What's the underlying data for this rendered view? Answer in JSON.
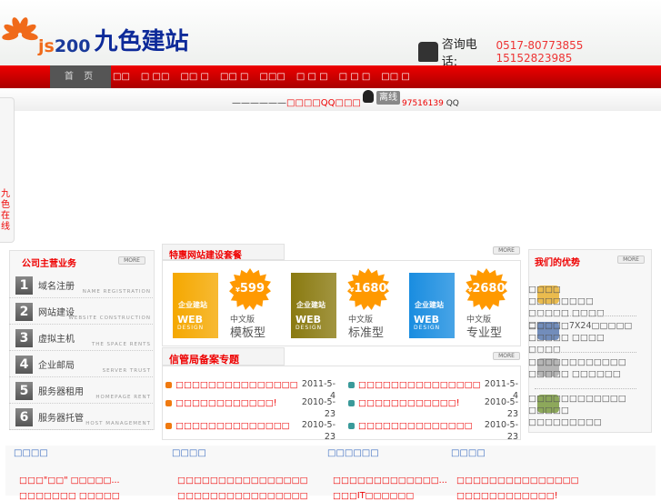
{
  "header": {
    "logo_js": "js",
    "logo_num": "200",
    "logo_cn": "九色建站",
    "phone_label": "咨询电话:",
    "phones": "0517-80773855  15152823985"
  },
  "nav": {
    "home": "首 页",
    "items": [
      "□□",
      "□ □□",
      "□□ □",
      "□□ □",
      "□□□",
      "□ □ □",
      "□ □ □",
      "□□ □"
    ]
  },
  "qq": {
    "dashes": "——————",
    "text": "□□□□QQ□□□",
    "status": "离线",
    "number": "97516139",
    "suffix": "QQ"
  },
  "side_tab": {
    "label": "九色在线"
  },
  "services": {
    "title": "公司主营业务",
    "more": "MORE",
    "items": [
      {
        "num": "1",
        "name": "域名注册",
        "en": "NAME REGISTRATION"
      },
      {
        "num": "2",
        "name": "网站建设",
        "en": "WEBSITE CONSTRUCTION"
      },
      {
        "num": "3",
        "name": "虚拟主机",
        "en": "THE SPACE RENTS"
      },
      {
        "num": "4",
        "name": "企业邮局",
        "en": "SERVER TRUST"
      },
      {
        "num": "5",
        "name": "服务器租用",
        "en": "HOMEPAGE RENT"
      },
      {
        "num": "6",
        "name": "服务器托管",
        "en": "HOST MANAGEMENT"
      }
    ]
  },
  "packages": {
    "title": "特惠网站建设套餐",
    "more": "MORE",
    "box_title": "企业建站",
    "box_web": "WEB",
    "box_design": "DESIGN",
    "items": [
      {
        "price": "599",
        "currency": "¥",
        "version": "中文版",
        "type": "模板型",
        "color": "#f5a800"
      },
      {
        "price": "1680",
        "currency": "¥",
        "version": "中文版",
        "type": "标准型",
        "color": "#8a7a10"
      },
      {
        "price": "2680",
        "currency": "¥",
        "version": "中文版",
        "type": "专业型",
        "color": "#1a8de0"
      }
    ]
  },
  "icp": {
    "title": "信管局备案专题",
    "more": "MORE",
    "left": [
      {
        "title": "□□□□□□□□□□□□□□□",
        "date": "2011-5-4"
      },
      {
        "title": "□□□□□□□□□□□□!",
        "date": "2010-5-23"
      },
      {
        "title": "□□□□□□□□□□□□□□",
        "date": "2010-5-23"
      }
    ],
    "right": [
      {
        "title": "□□□□□□□□□□□□□□□",
        "date": "2011-5-4"
      },
      {
        "title": "□□□□□□□□□□□□!",
        "date": "2010-5-23"
      },
      {
        "title": "□□□□□□□□□□□□□□",
        "date": "2010-5-23"
      }
    ]
  },
  "advantages": {
    "title": "我们的优势",
    "more": "MORE",
    "items": [
      {
        "line1": "□□□□ □□□□□□□□",
        "line2": "□□□□□ □□□□ □□□□"
      },
      {
        "line1": "□□□□□7X24□□□□□",
        "line2": "□□□□□ □□□□ □□□□"
      },
      {
        "line1": "□□□□□□□□□□□□",
        "line2": "□□□□□ □□□□□□"
      },
      {
        "line1": "□□□□□□□□□□□□",
        "line2": "□□□□□ □□□□□□□□□"
      }
    ]
  },
  "bottom": {
    "columns": [
      {
        "title": "□□□□",
        "links": [
          "□□□\"□□\" □□□□□...",
          "□□□□□□□ □□□□□"
        ]
      },
      {
        "title": "□□□□",
        "links": [
          "□□□□□□□□□□□□□□□□",
          "□□□□□□□□□□□□□□□□"
        ]
      },
      {
        "title": "□□□□□□",
        "links": [
          "□□□□□□□□□□□□□...",
          "□□□IT□□□□□□"
        ]
      },
      {
        "title": "□□□□",
        "links": [
          "□□□□□□□□□□□□□□□",
          "□□□□□□□□□□□□!"
        ]
      }
    ]
  },
  "colors": {
    "brand_red": "#dd0000",
    "link_blue": "#3a6bc0"
  }
}
